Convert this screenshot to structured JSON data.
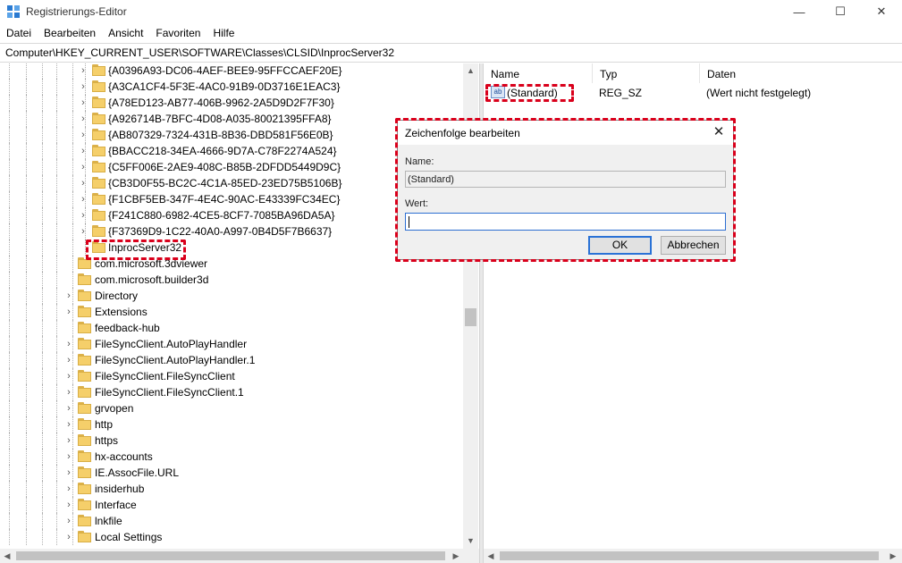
{
  "window": {
    "title": "Registrierungs-Editor",
    "min_glyph": "—",
    "max_glyph": "☐",
    "close_glyph": "✕"
  },
  "menu": [
    "Datei",
    "Bearbeiten",
    "Ansicht",
    "Favoriten",
    "Hilfe"
  ],
  "address": "Computer\\HKEY_CURRENT_USER\\SOFTWARE\\Classes\\CLSID\\InprocServer32",
  "tree": {
    "clsid_items": [
      "{A0396A93-DC06-4AEF-BEE9-95FFCCAEF20E}",
      "{A3CA1CF4-5F3E-4AC0-91B9-0D3716E1EAC3}",
      "{A78ED123-AB77-406B-9962-2A5D9D2F7F30}",
      "{A926714B-7BFC-4D08-A035-80021395FFA8}",
      "{AB807329-7324-431B-8B36-DBD581F56E0B}",
      "{BBACC218-34EA-4666-9D7A-C78F2274A524}",
      "{C5FF006E-2AE9-408C-B85B-2DFDD5449D9C}",
      "{CB3D0F55-BC2C-4C1A-85ED-23ED75B5106B}",
      "{F1CBF5EB-347F-4E4C-90AC-E43339FC34EC}",
      "{F241C880-6982-4CE5-8CF7-7085BA96DA5A}",
      "{F37369D9-1C22-40A0-A997-0B4D5F7B6637}"
    ],
    "selected": "InprocServer32",
    "class_items": [
      {
        "label": "com.microsoft.3dviewer",
        "expander": false
      },
      {
        "label": "com.microsoft.builder3d",
        "expander": false
      },
      {
        "label": "Directory",
        "expander": true
      },
      {
        "label": "Extensions",
        "expander": true
      },
      {
        "label": "feedback-hub",
        "expander": false
      },
      {
        "label": "FileSyncClient.AutoPlayHandler",
        "expander": true
      },
      {
        "label": "FileSyncClient.AutoPlayHandler.1",
        "expander": true
      },
      {
        "label": "FileSyncClient.FileSyncClient",
        "expander": true
      },
      {
        "label": "FileSyncClient.FileSyncClient.1",
        "expander": true
      },
      {
        "label": "grvopen",
        "expander": true
      },
      {
        "label": "http",
        "expander": true
      },
      {
        "label": "https",
        "expander": true
      },
      {
        "label": "hx-accounts",
        "expander": true
      },
      {
        "label": "IE.AssocFile.URL",
        "expander": true
      },
      {
        "label": "insiderhub",
        "expander": true
      },
      {
        "label": "Interface",
        "expander": true
      },
      {
        "label": "lnkfile",
        "expander": true
      },
      {
        "label": "Local Settings",
        "expander": true
      }
    ]
  },
  "values": {
    "columns": [
      "Name",
      "Typ",
      "Daten"
    ],
    "row": {
      "icon_text": "ab",
      "name": "(Standard)",
      "type": "REG_SZ",
      "data": "(Wert nicht festgelegt)"
    }
  },
  "dialog": {
    "title": "Zeichenfolge bearbeiten",
    "name_label": "Name:",
    "name_value": "(Standard)",
    "value_label": "Wert:",
    "value_text": "",
    "ok": "OK",
    "cancel": "Abbrechen"
  },
  "colors": {
    "highlight": "#d9001b",
    "folder": "#f5cf6a",
    "focus_border": "#2d6fd2"
  }
}
